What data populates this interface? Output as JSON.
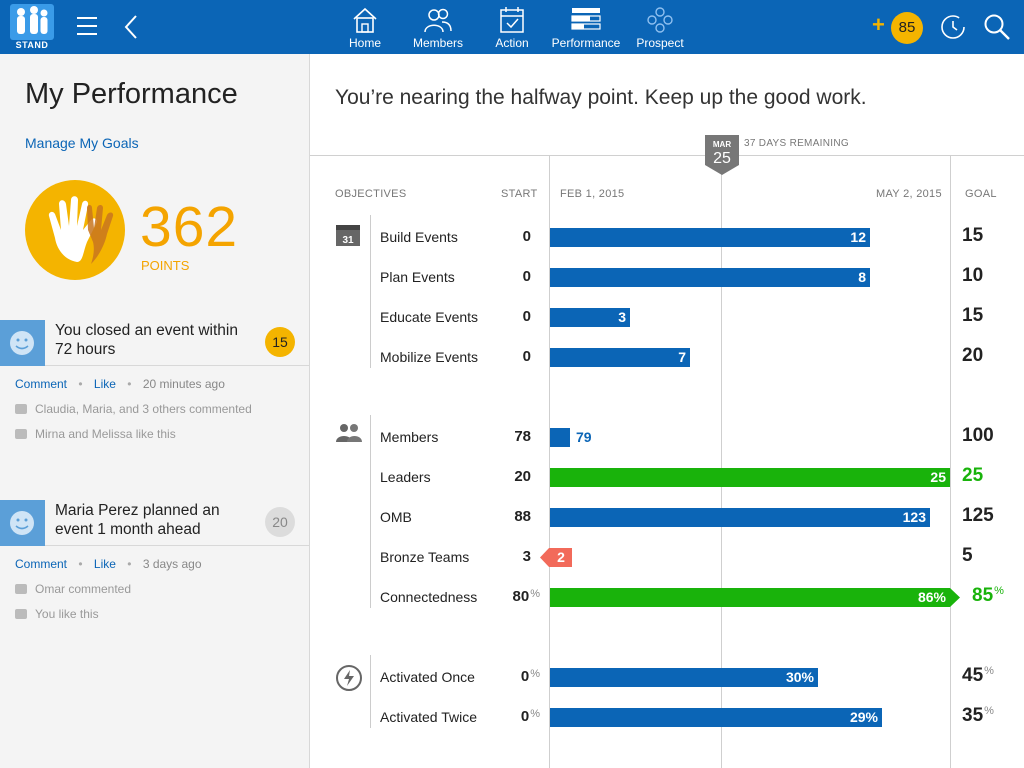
{
  "app": {
    "logo_text": "STAND"
  },
  "nav": [
    {
      "label": "Home",
      "icon": "home-icon"
    },
    {
      "label": "Members",
      "icon": "members-icon"
    },
    {
      "label": "Action",
      "icon": "calendar-check-icon"
    },
    {
      "label": "Performance",
      "icon": "bars-icon"
    },
    {
      "label": "Prospect",
      "icon": "prospect-icon"
    }
  ],
  "topbar": {
    "plus": "+",
    "points_badge": "85"
  },
  "left": {
    "title": "My Performance",
    "manage_link": "Manage My Goals",
    "points_value": "362",
    "points_label": "POINTS",
    "feed": [
      {
        "title": "You closed an event within 72 hours",
        "points": "15",
        "points_color": "#f4b400",
        "comment": "Comment",
        "like": "Like",
        "time": "20 minutes ago",
        "meta1": "Claudia, Maria, and 3 others commented",
        "meta2": "Mirna and Melissa like this"
      },
      {
        "title": "Maria Perez planned an event 1 month ahead",
        "points": "20",
        "points_color": "#dcdcdc",
        "comment": "Comment",
        "like": "Like",
        "time": "3 days ago",
        "meta1": "Omar commented",
        "meta2": "You like this"
      }
    ]
  },
  "main": {
    "headline": "You’re nearing the halfway point.  Keep up the good work.",
    "marker_month": "MAR",
    "marker_day": "25",
    "remaining": "37 DAYS REMAINING",
    "col_objectives": "OBJECTIVES",
    "col_start": "START",
    "col_from": "FEB 1, 2015",
    "col_to": "MAY 2, 2015",
    "col_goal": "GOAL",
    "rows": [
      {
        "label": "Build Events",
        "start": "0",
        "current": "12",
        "goal": "15",
        "progress": 0.8
      },
      {
        "label": "Plan Events",
        "start": "0",
        "current": "8",
        "goal": "10",
        "progress": 0.8
      },
      {
        "label": "Educate Events",
        "start": "0",
        "current": "3",
        "goal": "15",
        "progress": 0.2
      },
      {
        "label": "Mobilize Events",
        "start": "0",
        "current": "7",
        "goal": "20",
        "progress": 0.35
      },
      {
        "label": "Members",
        "start": "78",
        "current": "79",
        "goal": "100",
        "progress": 0.05
      },
      {
        "label": "Leaders",
        "start": "20",
        "current": "25",
        "goal": "25",
        "progress": 1.0
      },
      {
        "label": "OMB",
        "start": "88",
        "current": "123",
        "goal": "125",
        "progress": 0.95
      },
      {
        "label": "Bronze Teams",
        "start": "3",
        "current": "2",
        "goal": "5",
        "progress": -0.1
      },
      {
        "label": "Connectedness",
        "start": "80",
        "current": "86%",
        "goal": "85",
        "progress": 1.0
      },
      {
        "label": "Activated Once",
        "start": "0",
        "current": "30%",
        "goal": "45",
        "progress": 0.67
      },
      {
        "label": "Activated Twice",
        "start": "0",
        "current": "29%",
        "goal": "35",
        "progress": 0.83
      }
    ],
    "pct_sign": "%"
  }
}
